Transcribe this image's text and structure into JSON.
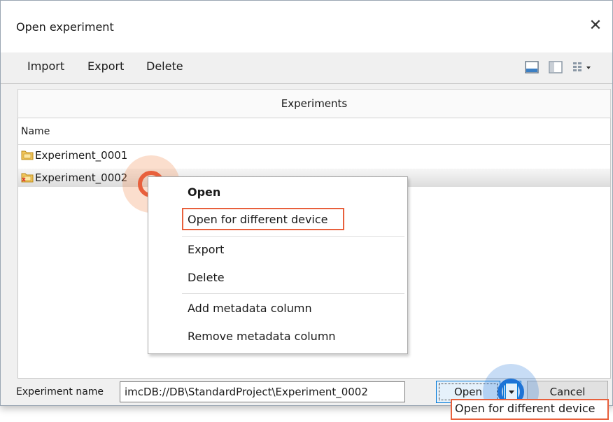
{
  "window": {
    "title": "Open experiment",
    "close_glyph": "✕"
  },
  "toolbar": {
    "import_label": "Import",
    "export_label": "Export",
    "delete_label": "Delete"
  },
  "panel": {
    "header": "Experiments",
    "column_name": "Name"
  },
  "experiments": [
    {
      "name": "Experiment_0001"
    },
    {
      "name": "Experiment_0002"
    }
  ],
  "context_menu": {
    "items": [
      {
        "label": "Open"
      },
      {
        "label": "Open for different device"
      },
      {
        "label": "Export"
      },
      {
        "label": "Delete"
      },
      {
        "label": "Add metadata column"
      },
      {
        "label": "Remove metadata column"
      }
    ]
  },
  "footer": {
    "name_label": "Experiment name",
    "name_value": "imcDB://DB\\StandardProject\\Experiment_0002",
    "open_label": "Open",
    "cancel_label": "Cancel",
    "dropdown_item": "Open for different device"
  },
  "colors": {
    "highlight": "#e8603c",
    "click_orange": "#f08a4b",
    "click_blue": "#1e73d6"
  }
}
